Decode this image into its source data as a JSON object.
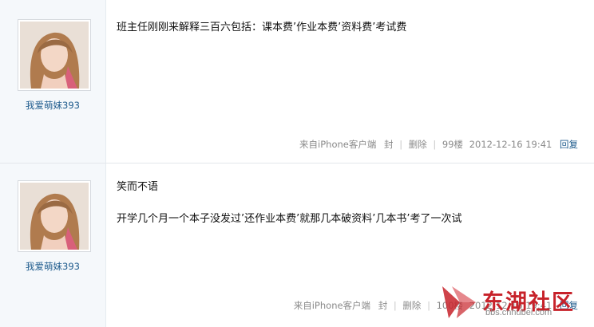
{
  "posts": [
    {
      "username": "我爱萌妹393",
      "lines": [
        "班主任刚刚来解释三百六包括：课本费’作业本费’资料费’考试费"
      ],
      "meta": {
        "source": "来自iPhone客户端",
        "block": "封",
        "delete": "删除",
        "floor": "99楼",
        "datetime": "2012-12-16 19:41",
        "reply": "回复"
      }
    },
    {
      "username": "我爱萌妹393",
      "lines": [
        "笑而不语",
        "开学几个月一个本子没发过’还作业本费’就那几本破资料’几本书’考了一次试"
      ],
      "meta": {
        "source": "来自iPhone客户端",
        "block": "封",
        "delete": "删除",
        "floor": "100楼",
        "datetime": "2012-12-16 19:41",
        "reply": "回复"
      }
    }
  ],
  "watermark": {
    "title": "东湖社区",
    "url": "bbs.cnhubei.com"
  },
  "colors": {
    "link": "#1d5a8c",
    "meta": "#8a8a8a",
    "brand": "#c7222a"
  }
}
